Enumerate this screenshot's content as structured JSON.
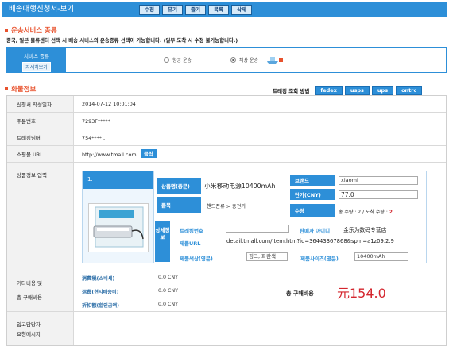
{
  "header": {
    "title": "배송대행신청서-보기",
    "buttons": [
      "수정",
      "목록",
      "삭제"
    ],
    "buttons_garbled": [
      "뮤기",
      "즐기"
    ]
  },
  "service_section": {
    "heading": "운송서비스 종류",
    "notice": "중국, 일본 물류센터 선택 시 배송 서비스의 운송종류 선택이 가능합니다. (일부 도착 시 수정 불가능합니다.)",
    "label": "서비스 종류",
    "detail_button": "자세히보기",
    "option_air": "항공 운송",
    "option_sea": "해상 운송",
    "selected": "해상 운송"
  },
  "goods_section": {
    "heading": "화물정보",
    "tracking_label": "트래킹 조회 방법",
    "tracking_buttons": [
      "fedex",
      "usps",
      "ups",
      "ontrc"
    ]
  },
  "rows": {
    "date_label": "신청서 작성일자",
    "date_value": "2014-07-12 10:01:04",
    "order_label": "주문번호",
    "order_value": "7293F*****",
    "tracking_label": "트래킹넘버",
    "tracking_value": "754****   ,",
    "mall_label": "쇼핑몰 URL",
    "mall_value": "http://www.tmall.com",
    "mall_button": "클릭",
    "goods_label": "상품정보 입력"
  },
  "item": {
    "index": "1.",
    "name_label": "상품명(중문)",
    "name_value": "小米移动电源10400mAh",
    "brand_label": "브랜드",
    "brand_value": "xiaomi",
    "price_label": "단가(CNY)",
    "price_value": "77.0",
    "category_label": "품목",
    "category_value": "핸드폰류 > 충전기",
    "qty_label": "수량",
    "qty_text": "총 수량 : 2 / 도착 수량 : ",
    "qty_arrived": "2",
    "side_label": "상세정보",
    "tracking_no_label": "트래킹번호",
    "seller_label": "판매자 아이디",
    "seller_value": "金乐为数码专营店",
    "url_label": "제품URL",
    "url_value": "detail.tmall.com/item.htm?id=36443367868&spm=a1z09.2.9",
    "color_label": "제품색상(영문)",
    "color_value": "핑크, 파란색",
    "size_label": "제품사이즈(영문)",
    "size_value": "10400mAh"
  },
  "costs": {
    "section_label_1": "기타비용 및",
    "section_label_2": "총 구매비용",
    "line1_label": "消费税(소비세)",
    "line1_value": "0.0 CNY",
    "line2_label": "运费(현지배송비)",
    "line2_value": "0.0 CNY",
    "line3_label": "折扣额(할인금액)",
    "line3_value": "0.0 CNY",
    "total_label": "총 구매비용",
    "total_value": "元154.0"
  },
  "memo": {
    "label_1": "입고담당자",
    "label_2": "요청메시지"
  },
  "colors": {
    "accent": "#2d8fd8",
    "section_title": "#e8522d",
    "total": "#d4262e"
  }
}
